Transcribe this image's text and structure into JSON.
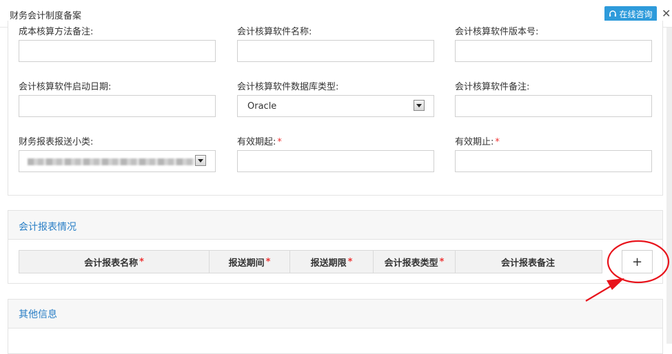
{
  "window": {
    "title": "财务会计制度备案",
    "consult_label": "在线咨询",
    "close_symbol": "✕"
  },
  "form": {
    "row1": [
      {
        "label": "成本核算方法备注:",
        "value": ""
      },
      {
        "label": "会计核算软件名称:",
        "value": ""
      },
      {
        "label": "会计核算软件版本号:",
        "value": ""
      }
    ],
    "row2": [
      {
        "label": "会计核算软件启动日期:",
        "value": ""
      },
      {
        "label": "会计核算软件数据库类型:",
        "value": "Oracle"
      },
      {
        "label": "会计核算软件备注:",
        "value": ""
      }
    ],
    "row3": [
      {
        "label": "财务报表报送小类:",
        "value": ""
      },
      {
        "label": "有效期起:",
        "required": "*",
        "value": ""
      },
      {
        "label": "有效期止:",
        "required": "*",
        "value": ""
      }
    ]
  },
  "report_section": {
    "title": "会计报表情况",
    "columns": [
      {
        "label": "会计报表名称",
        "required": "*"
      },
      {
        "label": "报送期间",
        "required": "*"
      },
      {
        "label": "报送期限",
        "required": "*"
      },
      {
        "label": "会计报表类型",
        "required": "*"
      },
      {
        "label": "会计报表备注",
        "required": ""
      }
    ],
    "add_label": "+"
  },
  "other_section": {
    "title": "其他信息"
  },
  "colors": {
    "accent": "#2e9bdb",
    "section_title": "#2a7fc6",
    "required": "#e33333",
    "annotation": "#e8141c"
  }
}
